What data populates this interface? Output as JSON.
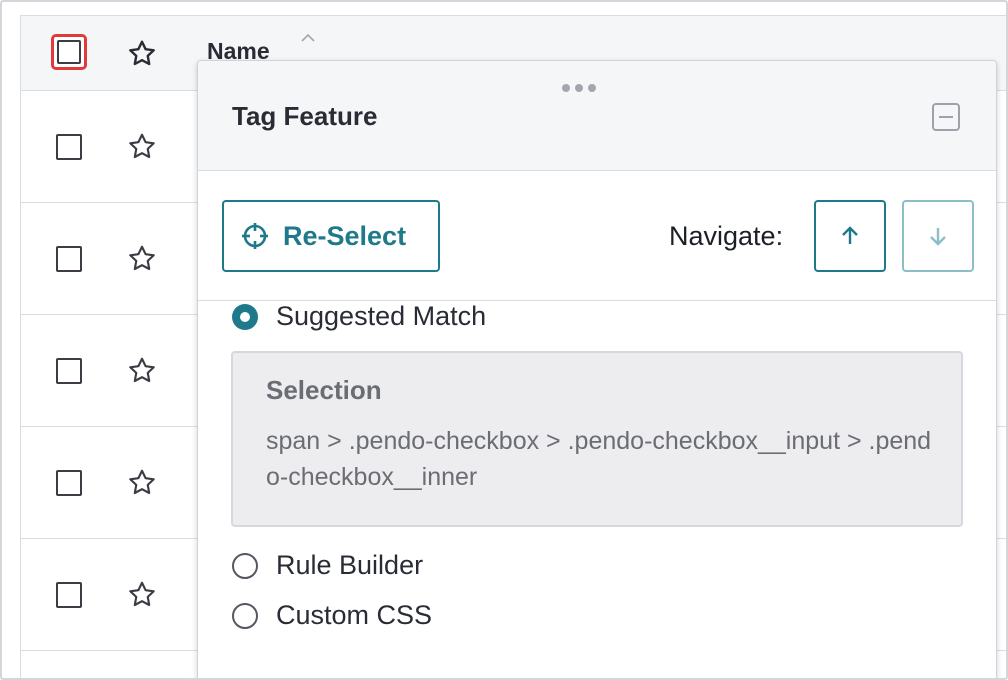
{
  "table": {
    "name_header": "Name",
    "row_count": 5
  },
  "panel": {
    "title": "Tag Feature",
    "reselect_label": "Re-Select",
    "navigate_label": "Navigate:",
    "options": {
      "suggested": "Suggested Match",
      "rule_builder": "Rule Builder",
      "custom_css": "Custom CSS"
    },
    "selected_option": "Suggested Match",
    "selection": {
      "title": "Selection",
      "value": "span > .pendo-checkbox > .pendo-checkbox__input > .pendo-checkbox__inner"
    }
  },
  "colors": {
    "accent": "#1e7a8a",
    "highlight": "#e03b3b"
  },
  "icons": [
    "star-icon",
    "sort-ascending-icon",
    "drag-handle-icon",
    "minimize-icon",
    "crosshair-icon",
    "arrow-up-icon",
    "arrow-down-icon"
  ]
}
